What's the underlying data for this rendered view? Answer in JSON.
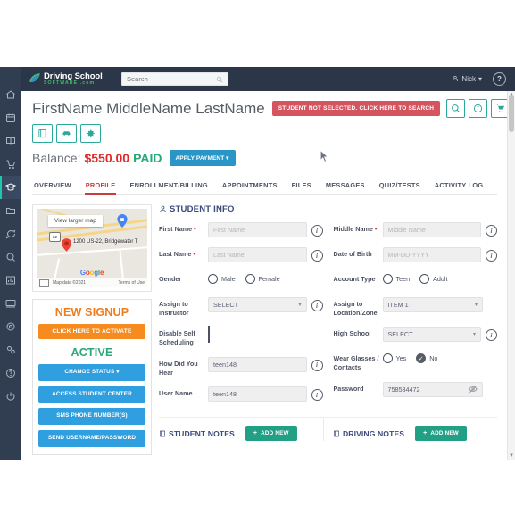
{
  "topbar": {
    "logo_title": "Driving School",
    "logo_sub": "SOFTWARE .com",
    "search_placeholder": "Search",
    "search_value": "",
    "user_name": "Nick",
    "user_caret": "▾",
    "help_label": "?"
  },
  "rail": {
    "items": [
      {
        "name": "home-icon",
        "label": "Home"
      },
      {
        "name": "calendar-icon",
        "label": "Calendar"
      },
      {
        "name": "book-icon",
        "label": "Courses"
      },
      {
        "name": "cart-icon",
        "label": "Store"
      },
      {
        "name": "graduation-cap-icon",
        "label": "Students"
      },
      {
        "name": "folder-icon",
        "label": "Files"
      },
      {
        "name": "chat-icon",
        "label": "Messages"
      },
      {
        "name": "search-icon",
        "label": "Search"
      },
      {
        "name": "chart-icon",
        "label": "Reports"
      },
      {
        "name": "monitor-icon",
        "label": "Online"
      },
      {
        "name": "gear-icon",
        "label": "Settings"
      },
      {
        "name": "gears-icon",
        "label": "Admin"
      },
      {
        "name": "help-icon",
        "label": "Help"
      },
      {
        "name": "power-icon",
        "label": "Logout"
      }
    ],
    "active_index": 4
  },
  "student": {
    "name": "FirstName MiddleName LastName",
    "not_selected_badge": "STUDENT NOT SELECTED. CLICK HERE TO SEARCH",
    "header_actions": [
      {
        "name": "search-action-icon"
      },
      {
        "name": "info-action-icon"
      },
      {
        "name": "cart-action-icon"
      },
      {
        "name": "money-action-icon"
      }
    ],
    "quick_icons": [
      {
        "name": "notebook-quick-icon"
      },
      {
        "name": "car-quick-icon"
      },
      {
        "name": "gear-quick-icon"
      }
    ]
  },
  "balance": {
    "label": "Balance:",
    "amount": "$550.00",
    "status": "PAID",
    "apply_payment_label": "APPLY PAYMENT ▾"
  },
  "tabs": [
    {
      "label": "OVERVIEW",
      "active": false
    },
    {
      "label": "PROFILE",
      "active": true
    },
    {
      "label": "ENROLLMENT/BILLING",
      "active": false
    },
    {
      "label": "APPOINTMENTS",
      "active": false
    },
    {
      "label": "FILES",
      "active": false
    },
    {
      "label": "MESSAGES",
      "active": false
    },
    {
      "label": "QUIZ/TESTS",
      "active": false
    },
    {
      "label": "ACTIVITY LOG",
      "active": false
    }
  ],
  "map": {
    "view_larger": "View larger map",
    "address": "1200 US-22, Bridgewater T",
    "shield_label": "22",
    "google": {
      "g1": "G",
      "o1": "o",
      "o2": "o",
      "g2": "g",
      "l": "l",
      "e": "e"
    },
    "attribution": "Map data ©2021",
    "terms": "Terms of Use"
  },
  "signup": {
    "title": "NEW SIGNUP",
    "activate_label": "CLICK HERE TO ACTIVATE",
    "status": "ACTIVE",
    "buttons": [
      "CHANGE STATUS ▾",
      "ACCESS STUDENT CENTER",
      "SMS PHONE NUMBER(S)",
      "SEND USERNAME/PASSWORD"
    ]
  },
  "student_info": {
    "title": "STUDENT INFO",
    "left_fields": [
      {
        "label": "First Name",
        "required": true,
        "type": "text",
        "placeholder": "First Name",
        "value": "",
        "info": true
      },
      {
        "label": "Last Name",
        "required": true,
        "type": "text",
        "placeholder": "Last Name",
        "value": "",
        "info": true
      },
      {
        "label": "Gender",
        "required": false,
        "type": "radio",
        "options": [
          "Male",
          "Female"
        ],
        "selected": -1,
        "info": false
      },
      {
        "label": "Assign to Instructor",
        "required": false,
        "type": "select",
        "value": "SELECT",
        "info": true
      },
      {
        "label": "Disable Self Scheduling",
        "required": false,
        "type": "checkbox",
        "checked": false,
        "info": false
      },
      {
        "label": "How Did You Hear",
        "required": false,
        "type": "text",
        "placeholder": "",
        "value": "teen148",
        "info": true
      },
      {
        "label": "User Name",
        "required": false,
        "type": "text",
        "placeholder": "",
        "value": "teen148",
        "info": true
      }
    ],
    "right_fields": [
      {
        "label": "Middle Name",
        "required": true,
        "type": "text",
        "placeholder": "Middle Name",
        "value": "",
        "info": true
      },
      {
        "label": "Date of Birth",
        "required": false,
        "type": "text",
        "placeholder": "MM-DD-YYYY",
        "value": "",
        "info": true
      },
      {
        "label": "Account Type",
        "required": false,
        "type": "radio",
        "options": [
          "Teen",
          "Adult"
        ],
        "selected": -1,
        "info": false
      },
      {
        "label": "Assign to Location/Zone",
        "required": false,
        "type": "select",
        "value": "ITEM 1",
        "info": false
      },
      {
        "label": "High School",
        "required": false,
        "type": "select",
        "value": "SELECT",
        "info": true
      },
      {
        "label": "Wear Glasses / Contacts",
        "required": false,
        "type": "radio",
        "options": [
          "Yes",
          "No"
        ],
        "selected": 1,
        "info": false
      },
      {
        "label": "Password",
        "required": false,
        "type": "password",
        "placeholder": "",
        "value": "758534472",
        "info": false,
        "eye": true
      }
    ]
  },
  "notes": [
    {
      "title": "STUDENT NOTES",
      "add_label": "ADD NEW",
      "plus": "+"
    },
    {
      "title": "DRIVING NOTES",
      "add_label": "ADD NEW",
      "plus": "+"
    }
  ],
  "colors": {
    "rail_bg": "#313e51",
    "topbar_bg": "#2b3648",
    "accent_teal": "#2aa89a",
    "accent_blue": "#2f9fe0",
    "accent_orange": "#f68b1f",
    "accent_red": "#d4555f",
    "accent_green": "#22a085",
    "title_navy": "#3a4a7a"
  }
}
